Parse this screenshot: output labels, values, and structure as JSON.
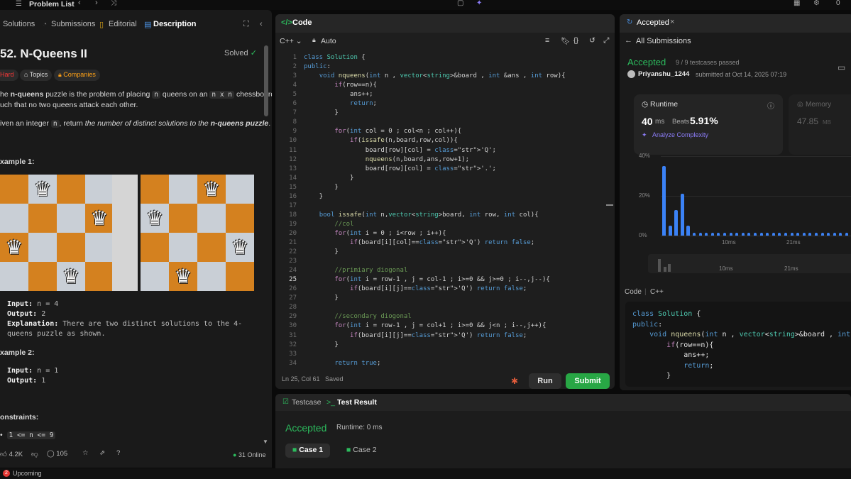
{
  "topbar": {
    "problem_list": "Problem List",
    "corner_count": "0"
  },
  "left": {
    "tabs": [
      "Solutions",
      "Submissions",
      "Editorial",
      "Description"
    ],
    "title": "52. N-Queens II",
    "solved": "Solved",
    "difficulty": "Hard",
    "topics": "Topics",
    "companies": "Companies",
    "desc_line1_pre": "he ",
    "desc_line1_bold": "n-queens",
    "desc_line1_mid": " puzzle is the problem of placing ",
    "desc_n": "n",
    "desc_line1_mid2": " queens on an ",
    "desc_nxn": "n x n",
    "desc_line1_post": " chessboard",
    "desc_line2": "uch that no two queens attack each other.",
    "desc_line3_pre": "iven an integer ",
    "desc_line3_mid": ", return ",
    "desc_line3_italic": "the number of distinct solutions to the ",
    "desc_line3_bold": "n-queens puzzle",
    "desc_line3_post": ".",
    "example1_label": "xample 1:",
    "ex1_input_label": "Input:",
    "ex1_input_val": "n = 4",
    "ex1_output_label": "Output:",
    "ex1_output_val": "2",
    "ex1_expl_label": "Explanation:",
    "ex1_expl_val1": "There are two distinct solutions to the 4-",
    "ex1_expl_val2": "queens puzzle as shown.",
    "example2_label": "xample 2:",
    "ex2_input_label": "Input:",
    "ex2_input_val": "n = 1",
    "ex2_output_label": "Output:",
    "ex2_output_val": "1",
    "constraints_label": "onstraints:",
    "constraint1": "1 <= n <= 9",
    "likes": "4.2K",
    "comments": "105",
    "online": "31 Online"
  },
  "boards": [
    {
      "queens": [
        [
          0,
          1
        ],
        [
          1,
          3
        ],
        [
          2,
          0
        ],
        [
          3,
          2
        ]
      ]
    },
    {
      "queens": [
        [
          0,
          2
        ],
        [
          1,
          0
        ],
        [
          2,
          3
        ],
        [
          3,
          1
        ]
      ]
    }
  ],
  "code": {
    "header": "Code",
    "language": "C++",
    "mode": "Auto",
    "status_pos": "Ln 25, Col 61",
    "status_saved": "Saved",
    "run": "Run",
    "submit": "Submit",
    "lines": [
      "class Solution {",
      "public:",
      "    void nqueens(int n , vector<string>&board , int &ans , int row){",
      "        if(row==n){",
      "            ans++;",
      "            return;",
      "        }",
      "",
      "        for(int col = 0 ; col<n ; col++){",
      "            if(issafe(n,board,row,col)){",
      "                board[row][col] = 'Q';",
      "                nqueens(n,board,ans,row+1);",
      "                board[row][col] = '.';",
      "            }",
      "        }",
      "    }",
      "",
      "    bool issafe(int n,vector<string>board, int row, int col){",
      "        //col",
      "        for(int i = 0 ; i<row ; i++){",
      "            if(board[i][col]=='Q') return false;",
      "        }",
      "",
      "        //primiary diogonal",
      "        for(int i = row-1 , j = col-1 ; i>=0 && j>=0 ; i--,j--){",
      "            if(board[i][j]=='Q') return false;",
      "        }",
      "",
      "        //secondary diogonal",
      "        for(int i = row-1 , j = col+1 ; i>=0 && j<n ; i--,j++){",
      "            if(board[i][j]=='Q') return false;",
      "        }",
      "",
      "        return true;"
    ]
  },
  "test": {
    "tab_testcase": "Testcase",
    "tab_result": "Test Result",
    "status": "Accepted",
    "runtime": "Runtime: 0 ms",
    "case1": "Case 1",
    "case2": "Case 2"
  },
  "right": {
    "tab": "Accepted",
    "all_submissions": "All Submissions",
    "status": "Accepted",
    "testcases": "9 / 9 testcases passed",
    "user": "Priyanshu_1244",
    "submitted": "submitted at Oct 14, 2025 07:19",
    "runtime_label": "Runtime",
    "runtime_value": "40",
    "runtime_unit": "ms",
    "beats_label": "Beats",
    "beats_value": "5.91%",
    "analyze": "Analyze Complexity",
    "memory_label": "Memory",
    "memory_value": "47.85",
    "memory_unit": "MB",
    "code_label": "Code",
    "code_lang": "C++",
    "snippet": [
      "class Solution {",
      "public:",
      "    void nqueens(int n , vector<string>&board , int &an",
      "        if(row==n){",
      "            ans++;",
      "            return;",
      "        }"
    ],
    "upcoming": "Upcoming"
  },
  "chart_data": {
    "type": "bar",
    "y_ticks": [
      "40%",
      "20%",
      "0%"
    ],
    "x_ticks": [
      "10ms",
      "21ms"
    ],
    "ylim": [
      0,
      40
    ],
    "values": [
      35,
      5,
      13,
      21,
      5,
      1.5,
      1.5,
      1.5,
      1.5,
      1.5,
      1.5,
      1.5,
      1.5,
      1.5,
      1.5,
      1.5,
      1.5,
      1.5,
      1.5,
      1.5,
      1.5,
      1.5,
      1.5,
      1.5,
      1.5,
      1.5,
      1.5,
      1.5,
      1.5,
      1.5,
      1.5,
      1.5,
      1.5,
      1.5,
      1.5
    ]
  }
}
